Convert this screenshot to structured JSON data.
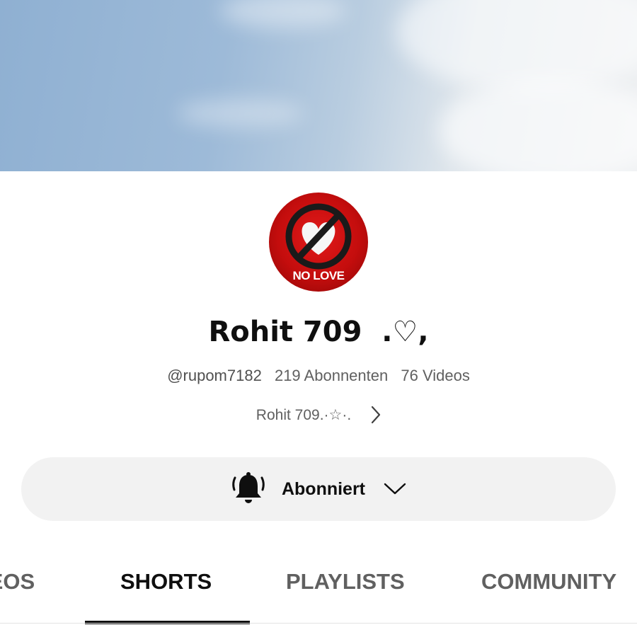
{
  "channel": {
    "avatar_text": "NO LOVE",
    "name": "Rohit 709  .♡,",
    "handle": "@rupom7182",
    "subscribers": "219 Abonnenten",
    "videos": "76 Videos",
    "description": "Rohit 709.·☆·."
  },
  "subscribe": {
    "label": "Abonniert",
    "icon": "bell-ringing-icon"
  },
  "tabs": [
    {
      "label": "VIDEOS",
      "active": false
    },
    {
      "label": "SHORTS",
      "active": true
    },
    {
      "label": "PLAYLISTS",
      "active": false
    },
    {
      "label": "COMMUNITY",
      "active": false
    }
  ],
  "colors": {
    "text_primary": "#0f0f0f",
    "text_secondary": "#606060",
    "button_bg": "#f2f2f2",
    "avatar_red": "#d11212"
  }
}
